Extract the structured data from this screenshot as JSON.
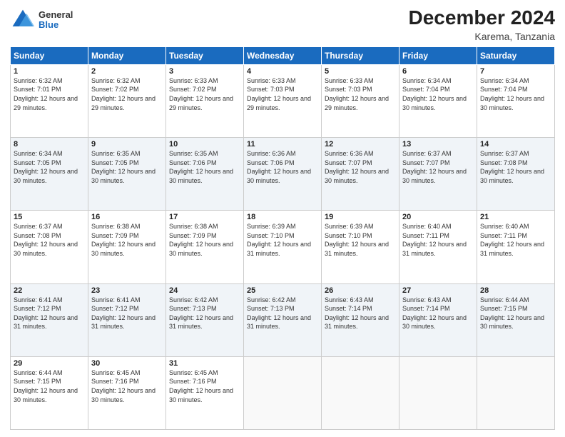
{
  "header": {
    "logo": {
      "general": "General",
      "blue": "Blue"
    },
    "month": "December 2024",
    "location": "Karema, Tanzania"
  },
  "weekdays": [
    "Sunday",
    "Monday",
    "Tuesday",
    "Wednesday",
    "Thursday",
    "Friday",
    "Saturday"
  ],
  "weeks": [
    [
      {
        "day": 1,
        "sunrise": "6:32 AM",
        "sunset": "7:01 PM",
        "daylight": "12 hours and 29 minutes."
      },
      {
        "day": 2,
        "sunrise": "6:32 AM",
        "sunset": "7:02 PM",
        "daylight": "12 hours and 29 minutes."
      },
      {
        "day": 3,
        "sunrise": "6:33 AM",
        "sunset": "7:02 PM",
        "daylight": "12 hours and 29 minutes."
      },
      {
        "day": 4,
        "sunrise": "6:33 AM",
        "sunset": "7:03 PM",
        "daylight": "12 hours and 29 minutes."
      },
      {
        "day": 5,
        "sunrise": "6:33 AM",
        "sunset": "7:03 PM",
        "daylight": "12 hours and 29 minutes."
      },
      {
        "day": 6,
        "sunrise": "6:34 AM",
        "sunset": "7:04 PM",
        "daylight": "12 hours and 30 minutes."
      },
      {
        "day": 7,
        "sunrise": "6:34 AM",
        "sunset": "7:04 PM",
        "daylight": "12 hours and 30 minutes."
      }
    ],
    [
      {
        "day": 8,
        "sunrise": "6:34 AM",
        "sunset": "7:05 PM",
        "daylight": "12 hours and 30 minutes."
      },
      {
        "day": 9,
        "sunrise": "6:35 AM",
        "sunset": "7:05 PM",
        "daylight": "12 hours and 30 minutes."
      },
      {
        "day": 10,
        "sunrise": "6:35 AM",
        "sunset": "7:06 PM",
        "daylight": "12 hours and 30 minutes."
      },
      {
        "day": 11,
        "sunrise": "6:36 AM",
        "sunset": "7:06 PM",
        "daylight": "12 hours and 30 minutes."
      },
      {
        "day": 12,
        "sunrise": "6:36 AM",
        "sunset": "7:07 PM",
        "daylight": "12 hours and 30 minutes."
      },
      {
        "day": 13,
        "sunrise": "6:37 AM",
        "sunset": "7:07 PM",
        "daylight": "12 hours and 30 minutes."
      },
      {
        "day": 14,
        "sunrise": "6:37 AM",
        "sunset": "7:08 PM",
        "daylight": "12 hours and 30 minutes."
      }
    ],
    [
      {
        "day": 15,
        "sunrise": "6:37 AM",
        "sunset": "7:08 PM",
        "daylight": "12 hours and 30 minutes."
      },
      {
        "day": 16,
        "sunrise": "6:38 AM",
        "sunset": "7:09 PM",
        "daylight": "12 hours and 30 minutes."
      },
      {
        "day": 17,
        "sunrise": "6:38 AM",
        "sunset": "7:09 PM",
        "daylight": "12 hours and 30 minutes."
      },
      {
        "day": 18,
        "sunrise": "6:39 AM",
        "sunset": "7:10 PM",
        "daylight": "12 hours and 31 minutes."
      },
      {
        "day": 19,
        "sunrise": "6:39 AM",
        "sunset": "7:10 PM",
        "daylight": "12 hours and 31 minutes."
      },
      {
        "day": 20,
        "sunrise": "6:40 AM",
        "sunset": "7:11 PM",
        "daylight": "12 hours and 31 minutes."
      },
      {
        "day": 21,
        "sunrise": "6:40 AM",
        "sunset": "7:11 PM",
        "daylight": "12 hours and 31 minutes."
      }
    ],
    [
      {
        "day": 22,
        "sunrise": "6:41 AM",
        "sunset": "7:12 PM",
        "daylight": "12 hours and 31 minutes."
      },
      {
        "day": 23,
        "sunrise": "6:41 AM",
        "sunset": "7:12 PM",
        "daylight": "12 hours and 31 minutes."
      },
      {
        "day": 24,
        "sunrise": "6:42 AM",
        "sunset": "7:13 PM",
        "daylight": "12 hours and 31 minutes."
      },
      {
        "day": 25,
        "sunrise": "6:42 AM",
        "sunset": "7:13 PM",
        "daylight": "12 hours and 31 minutes."
      },
      {
        "day": 26,
        "sunrise": "6:43 AM",
        "sunset": "7:14 PM",
        "daylight": "12 hours and 31 minutes."
      },
      {
        "day": 27,
        "sunrise": "6:43 AM",
        "sunset": "7:14 PM",
        "daylight": "12 hours and 30 minutes."
      },
      {
        "day": 28,
        "sunrise": "6:44 AM",
        "sunset": "7:15 PM",
        "daylight": "12 hours and 30 minutes."
      }
    ],
    [
      {
        "day": 29,
        "sunrise": "6:44 AM",
        "sunset": "7:15 PM",
        "daylight": "12 hours and 30 minutes."
      },
      {
        "day": 30,
        "sunrise": "6:45 AM",
        "sunset": "7:16 PM",
        "daylight": "12 hours and 30 minutes."
      },
      {
        "day": 31,
        "sunrise": "6:45 AM",
        "sunset": "7:16 PM",
        "daylight": "12 hours and 30 minutes."
      },
      null,
      null,
      null,
      null
    ]
  ]
}
